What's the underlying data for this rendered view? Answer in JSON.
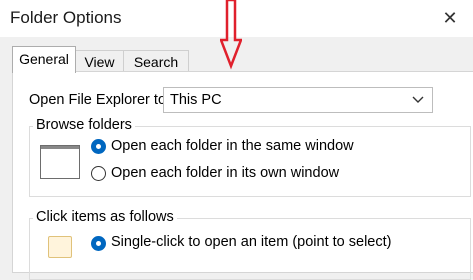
{
  "window": {
    "title": "Folder Options",
    "close_glyph": "✕"
  },
  "tabs": [
    {
      "label": "General",
      "active": true
    },
    {
      "label": "View",
      "active": false
    },
    {
      "label": "Search",
      "active": false
    }
  ],
  "general": {
    "open_explorer_label": "Open File Explorer to:",
    "open_explorer_value": "This PC",
    "browse_group": {
      "title": "Browse folders",
      "options": [
        {
          "label": "Open each folder in the same window",
          "selected": true
        },
        {
          "label": "Open each folder in its own window",
          "selected": false
        }
      ]
    },
    "click_group": {
      "title": "Click items as follows",
      "options": [
        {
          "label": "Single-click to open an item (point to select)",
          "selected": true
        }
      ]
    }
  },
  "colors": {
    "accent": "#0067c0",
    "annotation": "#e0202c"
  },
  "icons": [
    "close-icon",
    "down-arrow-annotation-icon",
    "chevron-down-icon",
    "folder-window-preview-icon",
    "click-preview-icon"
  ]
}
